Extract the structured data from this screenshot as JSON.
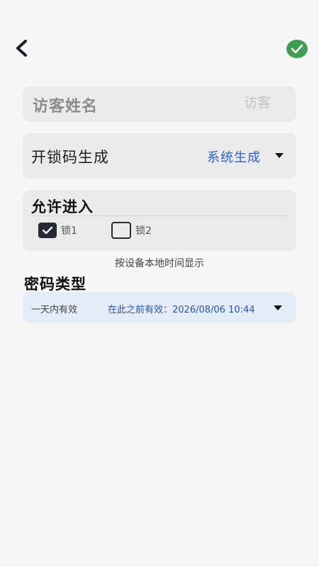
{
  "name_field": {
    "label": "访客姓名",
    "placeholder": "访客",
    "value": ""
  },
  "code_generation": {
    "label": "开锁码生成",
    "value": "系统生成"
  },
  "allow_entry": {
    "label": "允许进入",
    "locks": [
      {
        "label": "锁1",
        "checked": true
      },
      {
        "label": "锁2",
        "checked": false
      }
    ]
  },
  "time_hint": "按设备本地时间显示",
  "password_type": {
    "title": "密码类型",
    "type_label": "一天内有效",
    "valid_label": "在此之前有效：",
    "valid_date": "2026/08/06 10:44"
  },
  "colors": {
    "confirm": "#3f9e52",
    "link": "#2f62c4",
    "card": "#ebebeb"
  },
  "icons": {
    "back": "chevron-left-icon",
    "confirm": "check-circle-icon"
  }
}
